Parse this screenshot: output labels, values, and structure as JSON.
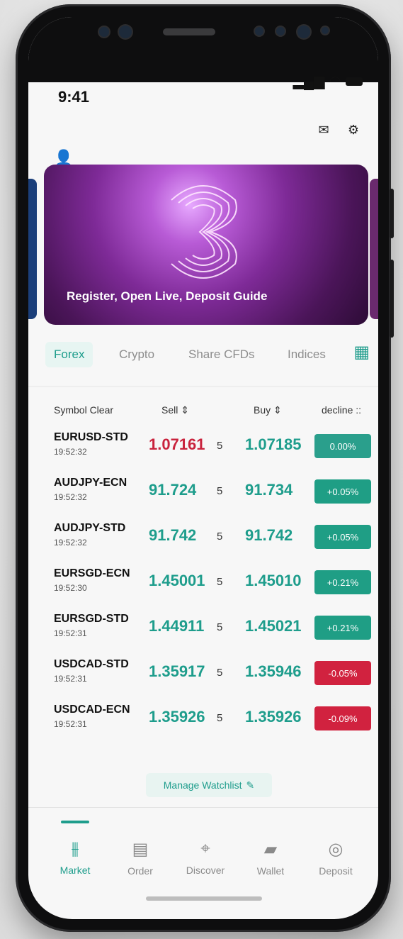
{
  "status": {
    "time": "9:41"
  },
  "banner": {
    "title": "Register, Open Live, Deposit Guide"
  },
  "tabs": [
    {
      "label": "Forex",
      "active": true
    },
    {
      "label": "Crypto",
      "active": false
    },
    {
      "label": "Share CFDs",
      "active": false
    },
    {
      "label": "Indices",
      "active": false
    }
  ],
  "table": {
    "headers": {
      "symbol": "Symbol Clear",
      "sell": "Sell ⇕",
      "buy": "Buy ⇕",
      "decline": "decline ::"
    },
    "rows": [
      {
        "symbol": "EURUSD-STD",
        "time": "19:52:32",
        "sell": "1.07161",
        "spread": "5",
        "buy": "1.07185",
        "change": "0.00%",
        "trend": "flat"
      },
      {
        "symbol": "AUDJPY-ECN",
        "time": "19:52:32",
        "sell": "91.724",
        "spread": "5",
        "buy": "91.734",
        "change": "+0.05%",
        "trend": "up"
      },
      {
        "symbol": "AUDJPY-STD",
        "time": "19:52:32",
        "sell": "91.742",
        "spread": "5",
        "buy": "91.742",
        "change": "+0.05%",
        "trend": "up"
      },
      {
        "symbol": "EURSGD-ECN",
        "time": "19:52:30",
        "sell": "1.45001",
        "spread": "5",
        "buy": "1.45010",
        "change": "+0.21%",
        "trend": "up"
      },
      {
        "symbol": "EURSGD-STD",
        "time": "19:52:31",
        "sell": "1.44911",
        "spread": "5",
        "buy": "1.45021",
        "change": "+0.21%",
        "trend": "up"
      },
      {
        "symbol": "USDCAD-STD",
        "time": "19:52:31",
        "sell": "1.35917",
        "spread": "5",
        "buy": "1.35946",
        "change": "-0.05%",
        "trend": "down"
      },
      {
        "symbol": "USDCAD-ECN",
        "time": "19:52:31",
        "sell": "1.35926",
        "spread": "5",
        "buy": "1.35926",
        "change": "-0.09%",
        "trend": "down"
      }
    ]
  },
  "watchlist": {
    "label": "Manage Watchlist"
  },
  "nav": {
    "items": [
      {
        "label": "Market",
        "icon": "candlestick-icon",
        "active": true
      },
      {
        "label": "Order",
        "icon": "document-icon",
        "active": false
      },
      {
        "label": "Discover",
        "icon": "telescope-icon",
        "active": false
      },
      {
        "label": "Wallet",
        "icon": "wallet-icon",
        "active": false
      },
      {
        "label": "Deposit",
        "icon": "coin-deposit-icon",
        "active": false
      }
    ]
  },
  "colors": {
    "accent": "#1e9d8c",
    "sell_red": "#c9233d",
    "positive": "#1e9d8c",
    "negative": "#d1223f"
  }
}
